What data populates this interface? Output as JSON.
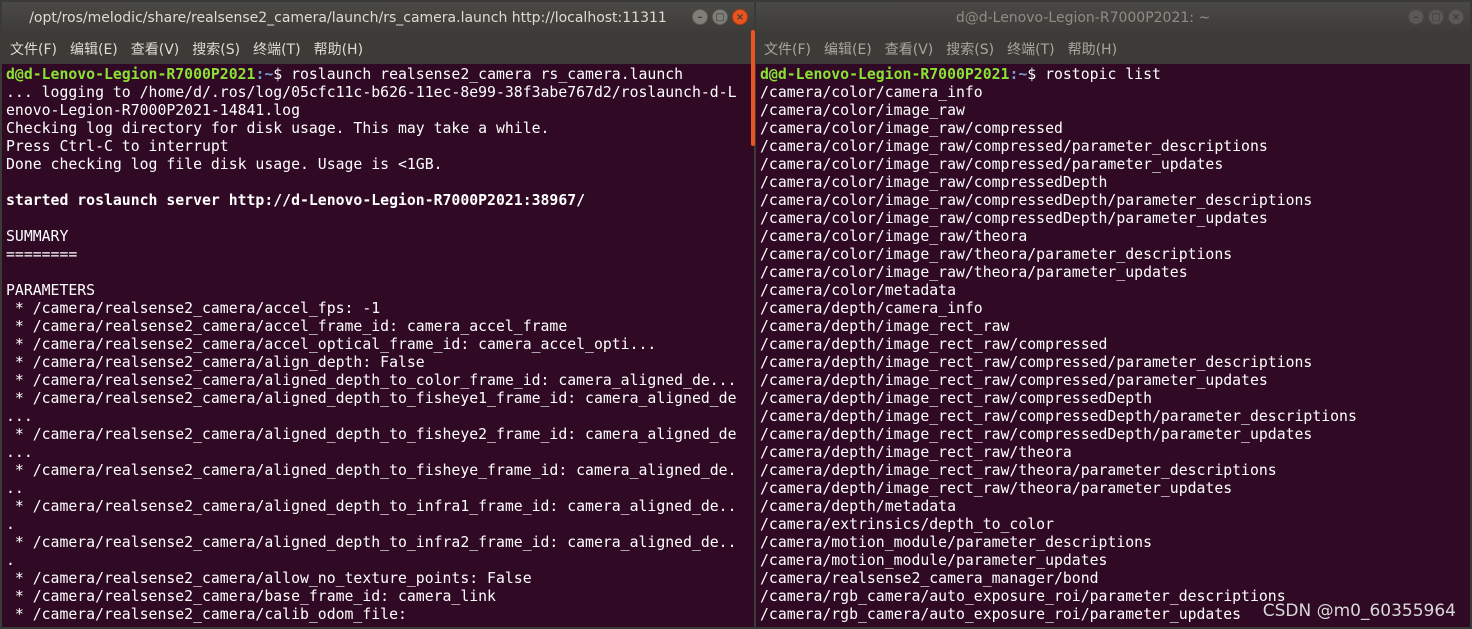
{
  "left_window": {
    "title": "/opt/ros/melodic/share/realsense2_camera/launch/rs_camera.launch http://localhost:11311",
    "menu": [
      "文件(F)",
      "编辑(E)",
      "查看(V)",
      "搜索(S)",
      "终端(T)",
      "帮助(H)"
    ],
    "prompt_user": "d@d-Lenovo-Legion-R7000P2021",
    "prompt_path": ":~",
    "command": "$ roslaunch realsense2_camera rs_camera.launch",
    "output_lines": [
      "... logging to /home/d/.ros/log/05cfc11c-b626-11ec-8e99-38f3abe767d2/roslaunch-d-L",
      "enovo-Legion-R7000P2021-14841.log",
      "Checking log directory for disk usage. This may take a while.",
      "Press Ctrl-C to interrupt",
      "Done checking log file disk usage. Usage is <1GB.",
      "",
      "started roslaunch server http://d-Lenovo-Legion-R7000P2021:38967/",
      "",
      "SUMMARY",
      "========",
      "",
      "PARAMETERS",
      " * /camera/realsense2_camera/accel_fps: -1",
      " * /camera/realsense2_camera/accel_frame_id: camera_accel_frame",
      " * /camera/realsense2_camera/accel_optical_frame_id: camera_accel_opti...",
      " * /camera/realsense2_camera/align_depth: False",
      " * /camera/realsense2_camera/aligned_depth_to_color_frame_id: camera_aligned_de...",
      " * /camera/realsense2_camera/aligned_depth_to_fisheye1_frame_id: camera_aligned_de",
      "...",
      " * /camera/realsense2_camera/aligned_depth_to_fisheye2_frame_id: camera_aligned_de",
      "...",
      " * /camera/realsense2_camera/aligned_depth_to_fisheye_frame_id: camera_aligned_de.",
      "..",
      " * /camera/realsense2_camera/aligned_depth_to_infra1_frame_id: camera_aligned_de..",
      ".",
      " * /camera/realsense2_camera/aligned_depth_to_infra2_frame_id: camera_aligned_de..",
      ".",
      " * /camera/realsense2_camera/allow_no_texture_points: False",
      " * /camera/realsense2_camera/base_frame_id: camera_link",
      " * /camera/realsense2_camera/calib_odom_file:"
    ],
    "bold_line_index": 6
  },
  "right_window": {
    "title": "d@d-Lenovo-Legion-R7000P2021: ~",
    "menu": [
      "文件(F)",
      "编辑(E)",
      "查看(V)",
      "搜索(S)",
      "终端(T)",
      "帮助(H)"
    ],
    "prompt_user": "d@d-Lenovo-Legion-R7000P2021",
    "prompt_path": ":~",
    "command": "$ rostopic list",
    "output_lines": [
      "/camera/color/camera_info",
      "/camera/color/image_raw",
      "/camera/color/image_raw/compressed",
      "/camera/color/image_raw/compressed/parameter_descriptions",
      "/camera/color/image_raw/compressed/parameter_updates",
      "/camera/color/image_raw/compressedDepth",
      "/camera/color/image_raw/compressedDepth/parameter_descriptions",
      "/camera/color/image_raw/compressedDepth/parameter_updates",
      "/camera/color/image_raw/theora",
      "/camera/color/image_raw/theora/parameter_descriptions",
      "/camera/color/image_raw/theora/parameter_updates",
      "/camera/color/metadata",
      "/camera/depth/camera_info",
      "/camera/depth/image_rect_raw",
      "/camera/depth/image_rect_raw/compressed",
      "/camera/depth/image_rect_raw/compressed/parameter_descriptions",
      "/camera/depth/image_rect_raw/compressed/parameter_updates",
      "/camera/depth/image_rect_raw/compressedDepth",
      "/camera/depth/image_rect_raw/compressedDepth/parameter_descriptions",
      "/camera/depth/image_rect_raw/compressedDepth/parameter_updates",
      "/camera/depth/image_rect_raw/theora",
      "/camera/depth/image_rect_raw/theora/parameter_descriptions",
      "/camera/depth/image_rect_raw/theora/parameter_updates",
      "/camera/depth/metadata",
      "/camera/extrinsics/depth_to_color",
      "/camera/motion_module/parameter_descriptions",
      "/camera/motion_module/parameter_updates",
      "/camera/realsense2_camera_manager/bond",
      "/camera/rgb_camera/auto_exposure_roi/parameter_descriptions",
      "/camera/rgb_camera/auto_exposure_roi/parameter_updates"
    ]
  },
  "window_controls": {
    "minimize_glyph": "–",
    "maximize_glyph": "□",
    "close_glyph": "×"
  },
  "watermark": "CSDN @m0_60355964",
  "colors": {
    "terminal_bg": "#300a24",
    "prompt_user": "#8ae234",
    "prompt_path": "#729fcf",
    "close_button": "#e9541f",
    "scrollbar": "#e95420"
  }
}
